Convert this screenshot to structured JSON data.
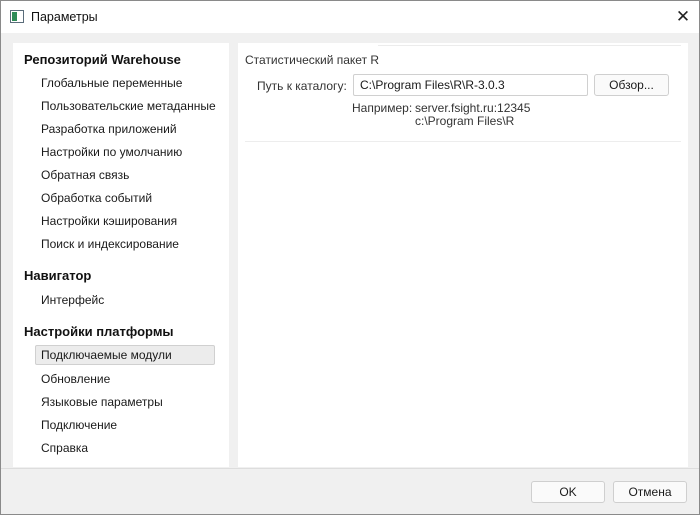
{
  "window": {
    "title": "Параметры",
    "icon": "app-icon",
    "close_glyph": "✕"
  },
  "sidebar": {
    "groups": [
      {
        "title": "Репозиторий Warehouse",
        "items": [
          {
            "label": "Глобальные переменные"
          },
          {
            "label": "Пользовательские метаданные"
          },
          {
            "label": "Разработка приложений"
          },
          {
            "label": "Настройки по умолчанию"
          },
          {
            "label": "Обратная связь"
          },
          {
            "label": "Обработка событий"
          },
          {
            "label": "Настройки кэширования"
          },
          {
            "label": "Поиск и индексирование"
          }
        ]
      },
      {
        "title": "Навигатор",
        "items": [
          {
            "label": "Интерфейс"
          }
        ]
      },
      {
        "title": "Настройки платформы",
        "items": [
          {
            "label": "Подключаемые модули",
            "selected": true
          },
          {
            "label": "Обновление"
          },
          {
            "label": "Языковые параметры"
          },
          {
            "label": "Подключение"
          },
          {
            "label": "Справка"
          }
        ]
      }
    ]
  },
  "main": {
    "section_title": "Статистический пакет R",
    "path_label": "Путь к каталогу:",
    "path_value": "C:\\Program Files\\R\\R-3.0.3",
    "browse_label": "Обзор...",
    "example_label": "Например:",
    "example_line1": "server.fsight.ru:12345",
    "example_line2": "c:\\Program Files\\R"
  },
  "footer": {
    "ok_label": "OK",
    "cancel_label": "Отмена"
  },
  "colors": {
    "selected_bg": "#ececec",
    "content_bg": "#f0f0f0",
    "icon_green": "#2e8b57"
  }
}
